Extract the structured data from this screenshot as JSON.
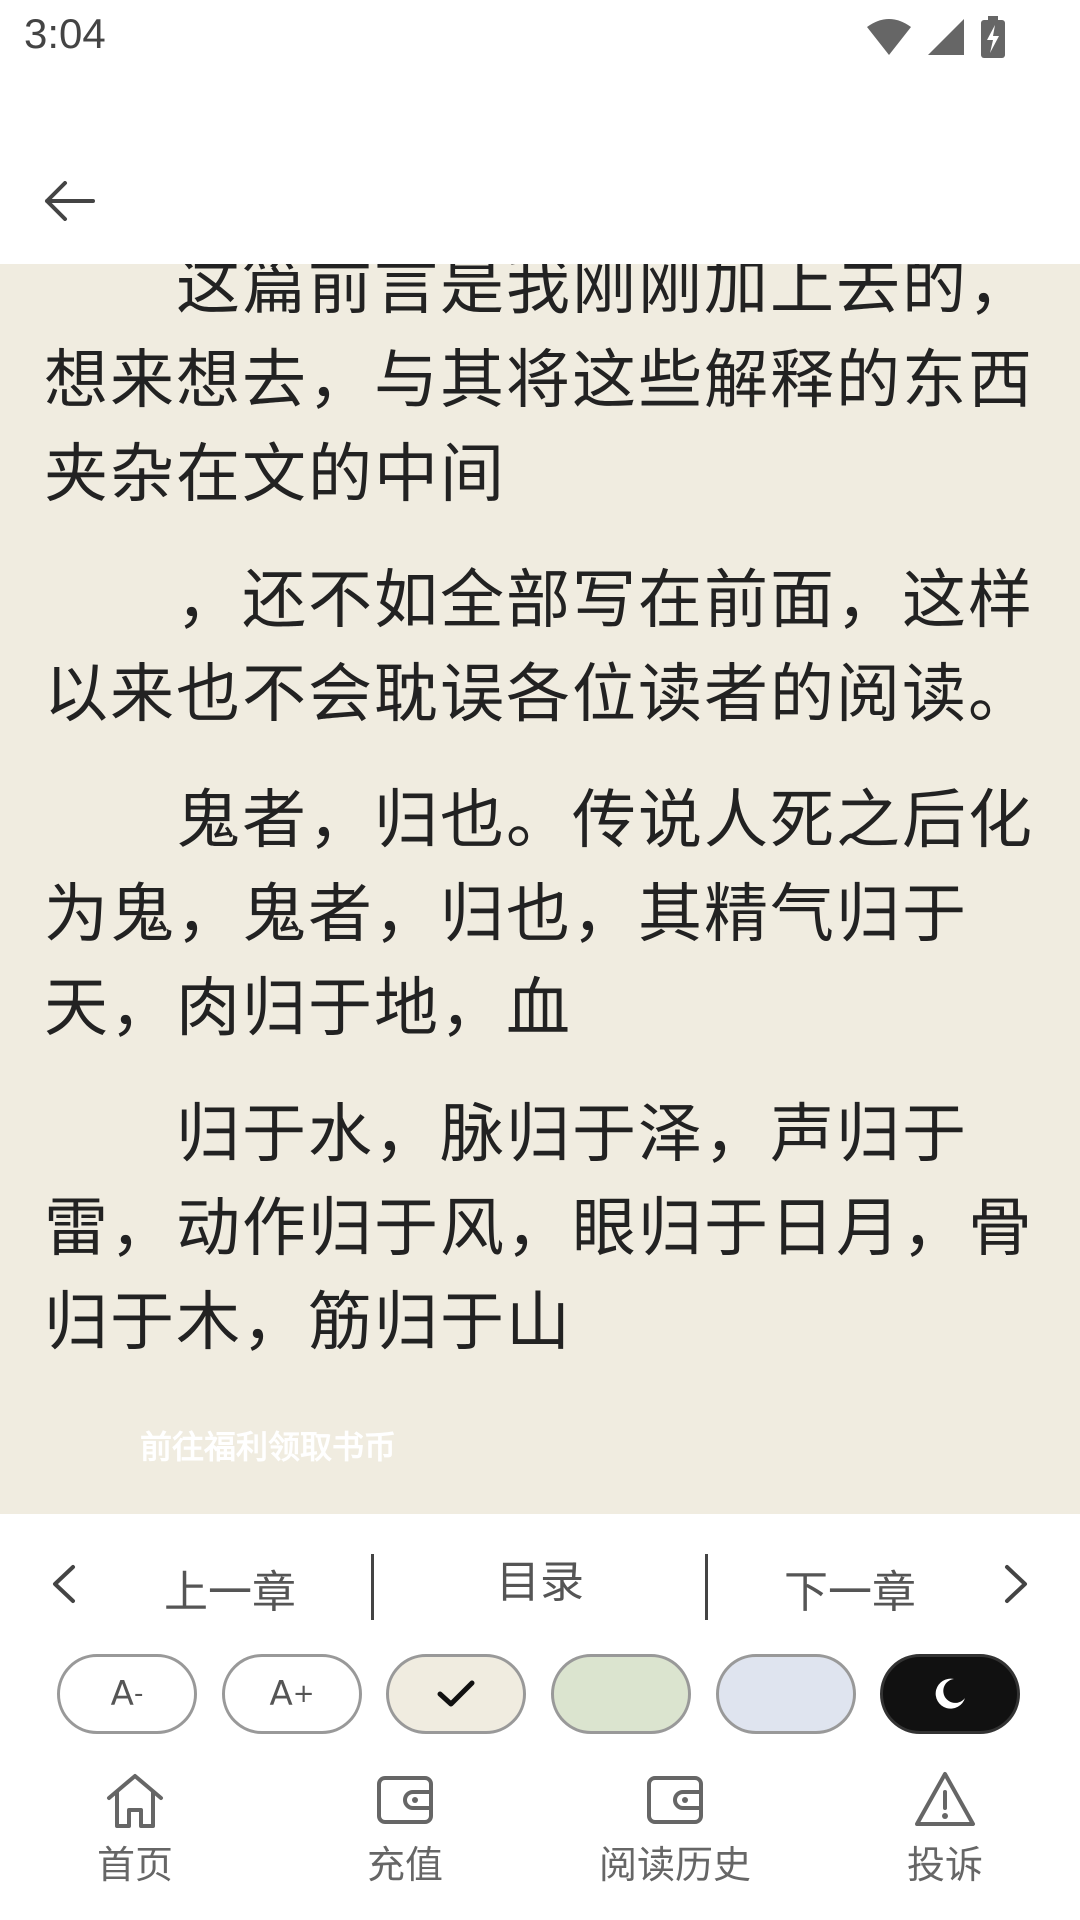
{
  "status_bar": {
    "time": "3:04"
  },
  "reader": {
    "paragraphs": [
      "这篇前言是我刚刚加上去的，想来想去，与其将这些解释的东西夹杂在文的中间",
      "，还不如全部写在前面，这样以来也不会耽误各位读者的阅读。",
      "鬼者，归也。传说人死之后化为鬼，鬼者，归也，其精气归于天，肉归于地，血",
      "归于水，脉归于泽，声归于雷，动作归于风，眼归于日月，骨归于木，筋归于山"
    ],
    "promo_text": "前往福利领取书币"
  },
  "chapter_nav": {
    "prev_label": "上一章",
    "toc_label": "目录",
    "next_label": "下一章"
  },
  "theme_buttons": {
    "font_decrease_label": "A",
    "font_decrease_mark": "-",
    "font_increase_label": "A",
    "font_increase_mark": "+",
    "themes": [
      {
        "name": "beige",
        "color": "#f0ece0",
        "selected": true
      },
      {
        "name": "green",
        "color": "#dbe4cf",
        "selected": false
      },
      {
        "name": "blue",
        "color": "#dfe4ef",
        "selected": false
      },
      {
        "name": "night",
        "color": "#111111",
        "selected": false
      }
    ]
  },
  "tabbar": {
    "tabs": [
      {
        "label": "首页",
        "icon": "home-icon"
      },
      {
        "label": "充值",
        "icon": "wallet-icon"
      },
      {
        "label": "阅读历史",
        "icon": "history-wallet-icon"
      },
      {
        "label": "投诉",
        "icon": "warning-icon"
      }
    ]
  },
  "colors": {
    "reader_bg": "#f0ece0",
    "text": "#222222"
  }
}
